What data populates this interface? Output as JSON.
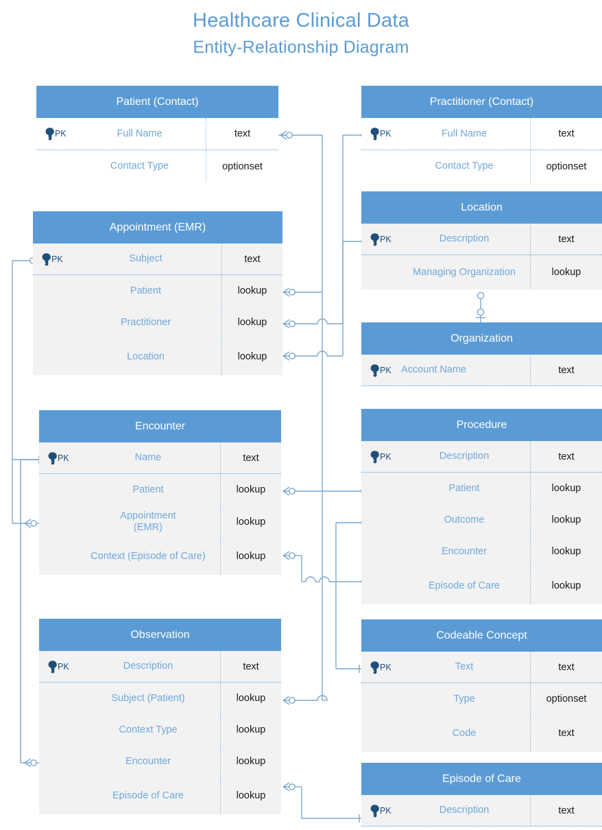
{
  "title": {
    "line1": "Healthcare Clinical Data",
    "line2": "Entity-Relationship Diagram"
  },
  "theme": {
    "header_blue": "#5B9BD5",
    "attribute_blue": "#6FA8DC",
    "row_shade": "#F2F2F2",
    "connector_blue": "#7BA7CE",
    "key_navy": "#1F4E79",
    "title_blue": "#5B9BD5"
  },
  "labels": {
    "pk": "PK",
    "key_icon": "key-icon"
  },
  "entities": [
    {
      "id": "patient",
      "name": "Patient (Contact)",
      "shaded": false,
      "attributes": [
        {
          "pk": true,
          "name": "Full Name",
          "type": "text"
        },
        {
          "pk": false,
          "name": "Contact Type",
          "type": "optionset"
        }
      ]
    },
    {
      "id": "appointment",
      "name": "Appointment (EMR)",
      "shaded": true,
      "attributes": [
        {
          "pk": true,
          "name": "Subject",
          "type": "text"
        },
        {
          "pk": false,
          "name": "Patient",
          "type": "lookup"
        },
        {
          "pk": false,
          "name": "Practitioner",
          "type": "lookup"
        },
        {
          "pk": false,
          "name": "Location",
          "type": "lookup"
        }
      ]
    },
    {
      "id": "encounter",
      "name": "Encounter",
      "shaded": true,
      "attributes": [
        {
          "pk": true,
          "name": "Name",
          "type": "text"
        },
        {
          "pk": false,
          "name": "Patient",
          "type": "lookup"
        },
        {
          "pk": false,
          "name": "Appointment\n(EMR)",
          "type": "lookup"
        },
        {
          "pk": false,
          "name": "Context (Episode of Care)",
          "type": "lookup"
        }
      ]
    },
    {
      "id": "observation",
      "name": "Observation",
      "shaded": true,
      "attributes": [
        {
          "pk": true,
          "name": "Description",
          "type": "text"
        },
        {
          "pk": false,
          "name": "Subject (Patient)",
          "type": "lookup"
        },
        {
          "pk": false,
          "name": "Context Type",
          "type": "lookup"
        },
        {
          "pk": false,
          "name": "Encounter",
          "type": "lookup"
        },
        {
          "pk": false,
          "name": "Episode of Care",
          "type": "lookup"
        }
      ]
    },
    {
      "id": "practitioner",
      "name": "Practitioner (Contact)",
      "shaded": false,
      "attributes": [
        {
          "pk": true,
          "name": "Full Name",
          "type": "text"
        },
        {
          "pk": false,
          "name": "Contact Type",
          "type": "optionset"
        }
      ]
    },
    {
      "id": "location",
      "name": "Location",
      "shaded": true,
      "attributes": [
        {
          "pk": true,
          "name": "Description",
          "type": "text"
        },
        {
          "pk": false,
          "name": "Managing Organization",
          "type": "lookup"
        }
      ]
    },
    {
      "id": "organization",
      "name": "Organization",
      "shaded": true,
      "attributes": [
        {
          "pk": true,
          "name": "Account Name",
          "type": "text"
        }
      ]
    },
    {
      "id": "procedure",
      "name": "Procedure",
      "shaded": true,
      "attributes": [
        {
          "pk": true,
          "name": "Description",
          "type": "text"
        },
        {
          "pk": false,
          "name": "Patient",
          "type": "lookup"
        },
        {
          "pk": false,
          "name": "Outcome",
          "type": "lookup"
        },
        {
          "pk": false,
          "name": "Encounter",
          "type": "lookup"
        },
        {
          "pk": false,
          "name": "Episode of Care",
          "type": "lookup"
        }
      ]
    },
    {
      "id": "codeable_concept",
      "name": "Codeable Concept",
      "shaded": true,
      "attributes": [
        {
          "pk": true,
          "name": "Text",
          "type": "text"
        },
        {
          "pk": false,
          "name": "Type",
          "type": "optionset"
        },
        {
          "pk": false,
          "name": "Code",
          "type": "text"
        }
      ]
    },
    {
      "id": "episode_of_care",
      "name": "Episode of Care",
      "shaded": true,
      "attributes": [
        {
          "pk": true,
          "name": "Description",
          "type": "text"
        }
      ]
    }
  ],
  "relationships": [
    {
      "from": "appointment.Patient",
      "to": "patient.Full Name",
      "from_card": "many",
      "to_card": "one-optional"
    },
    {
      "from": "appointment.Practitioner",
      "to": "practitioner.Full Name",
      "from_card": "many",
      "to_card": "one-optional"
    },
    {
      "from": "appointment.Location",
      "to": "location.Description",
      "from_card": "many",
      "to_card": "one-optional"
    },
    {
      "from": "location.Managing Organization",
      "to": "organization.Account Name",
      "from_card": "many",
      "to_card": "one"
    },
    {
      "from": "encounter.Patient",
      "to": "patient.Full Name",
      "from_card": "many",
      "to_card": "one-optional"
    },
    {
      "from": "encounter.Appointment (EMR)",
      "to": "appointment.Subject",
      "from_card": "many",
      "to_card": "one"
    },
    {
      "from": "encounter.Context (Episode of Care)",
      "to": "episode_of_care.Description",
      "from_card": "many",
      "to_card": "one"
    },
    {
      "from": "procedure.Patient",
      "to": "patient.Full Name",
      "from_card": "many",
      "to_card": "one-optional"
    },
    {
      "from": "procedure.Outcome",
      "to": "codeable_concept.Text",
      "from_card": "many",
      "to_card": "one"
    },
    {
      "from": "procedure.Episode of Care",
      "to": "episode_of_care.Description",
      "from_card": "many",
      "to_card": "one"
    },
    {
      "from": "observation.Subject (Patient)",
      "to": "patient.Full Name",
      "from_card": "many",
      "to_card": "one-optional"
    },
    {
      "from": "observation.Encounter",
      "to": "encounter.Name",
      "from_card": "many",
      "to_card": "one"
    },
    {
      "from": "observation.Episode of Care",
      "to": "episode_of_care.Description",
      "from_card": "many",
      "to_card": "one"
    }
  ]
}
